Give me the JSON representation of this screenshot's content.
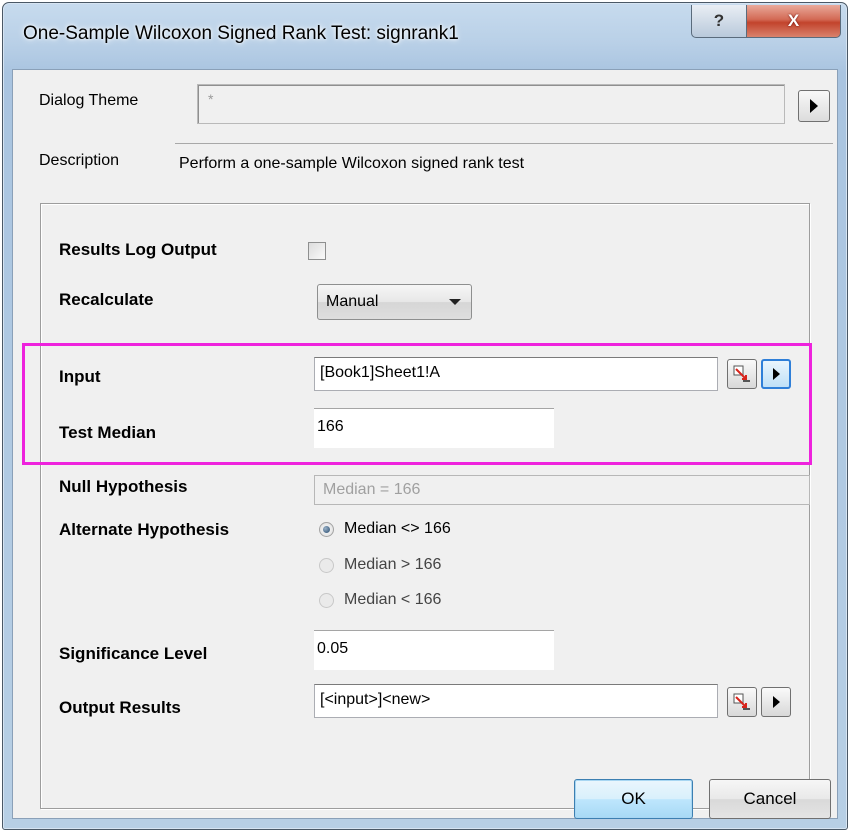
{
  "window": {
    "title": "One-Sample Wilcoxon Signed Rank Test: signrank1",
    "help_glyph": "?",
    "close_glyph": "X"
  },
  "dialog_theme": {
    "label": "Dialog Theme",
    "value": "*"
  },
  "description": {
    "label": "Description",
    "value": "Perform a one-sample Wilcoxon signed rank test"
  },
  "form": {
    "results_log_output": {
      "label": "Results Log Output",
      "checked": false
    },
    "recalculate": {
      "label": "Recalculate",
      "value": "Manual"
    },
    "input": {
      "label": "Input",
      "value": "[Book1]Sheet1!A"
    },
    "test_median": {
      "label": "Test Median",
      "value": "166"
    },
    "null_hypothesis": {
      "label": "Null Hypothesis",
      "value": "Median = 166"
    },
    "alternate_hypothesis": {
      "label": "Alternate Hypothesis",
      "options": [
        "Median <> 166",
        "Median > 166",
        "Median < 166"
      ],
      "selected": 0
    },
    "significance_level": {
      "label": "Significance Level",
      "value": "0.05"
    },
    "output_results": {
      "label": "Output Results",
      "value": "[<input>]<new>"
    }
  },
  "buttons": {
    "ok": "OK",
    "cancel": "Cancel"
  },
  "colors": {
    "highlight_border": "#ee22dd",
    "client_bg": "#f0f0f0"
  }
}
